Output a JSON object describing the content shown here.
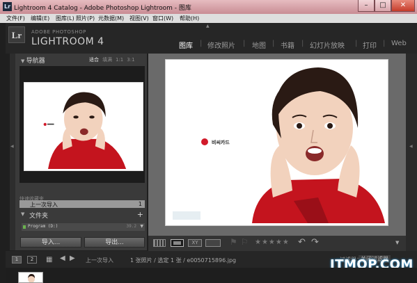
{
  "window": {
    "app_icon": "Lr",
    "title": "Lightroom 4 Catalog - Adobe Photoshop Lightroom - 图库",
    "minimize": "–",
    "maximize": "□",
    "close": "✕"
  },
  "menubar": {
    "items": [
      "文件(F)",
      "编辑(E)",
      "图库(L)",
      "照片(P)",
      "元数据(M)",
      "视图(V)",
      "窗口(W)",
      "帮助(H)"
    ]
  },
  "identity": {
    "logo": "Lr",
    "brand": "ADOBE PHOTOSHOP",
    "product": "LIGHTROOM 4"
  },
  "modules": {
    "items": [
      "图库",
      "修改照片",
      "地图",
      "书籍",
      "幻灯片放映",
      "打印",
      "Web"
    ],
    "active": "图库",
    "separator": "|"
  },
  "navigator": {
    "title": "导航器",
    "zoom_options": [
      "适合",
      "填满",
      "1:1",
      "3:1"
    ],
    "selected_zoom": "适合"
  },
  "collections": {
    "partial_item": "快速收藏夹",
    "last_import_label": "上一次导入",
    "last_import_count": "1"
  },
  "folders": {
    "title": "文件夹",
    "add": "+",
    "volume_name": "Program (D:)",
    "volume_size": "39.2"
  },
  "buttons": {
    "import": "导入...",
    "export": "导出..."
  },
  "toolbar": {
    "compare_label": "XY",
    "stars": "★★★★★",
    "menu": "▼"
  },
  "filmstrip_bar": {
    "page_1": "1",
    "page_2": "2",
    "source": "上一次导入",
    "count": "1 张照片 / 选定 1 张 / e0050715896.jpg",
    "filter_label": "过滤器：",
    "filter_value": "关闭过滤器"
  },
  "watermark": "ITMOP.COM",
  "photo": {
    "logo_text": "비씨카드",
    "skin": "#f2d2bd",
    "hair": "#2a1a14",
    "jacket": "#c4141e"
  }
}
